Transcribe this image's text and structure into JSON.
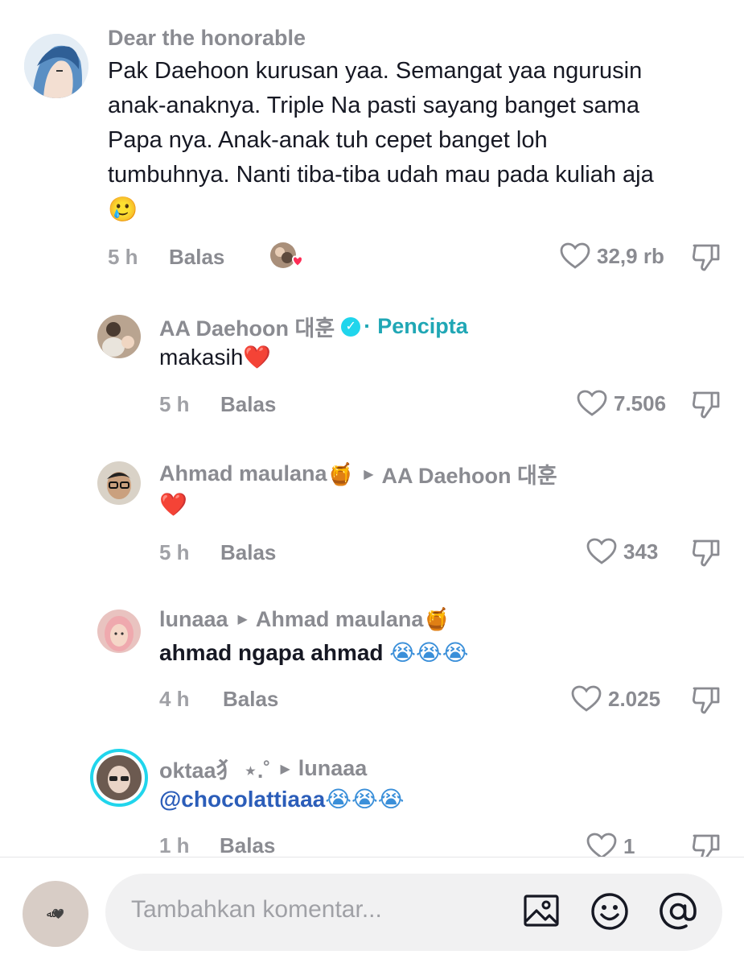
{
  "comments": {
    "main": {
      "username": "Dear the honorable",
      "text_lines": [
        "Pak Daehoon kurusan yaa. Semangat yaa ngurusin",
        "anak-anaknya. Triple Na pasti sayang banget sama",
        "Papa nya. Anak-anak tuh cepet banget loh",
        "tumbuhnya. Nanti tiba-tiba udah mau pada kuliah aja"
      ],
      "emoji": "🥲",
      "time": "5 h",
      "reply_label": "Balas",
      "likes": "32,9 rb"
    },
    "replies": [
      {
        "username": "AA Daehoon 대훈",
        "badge": "✓",
        "separator": "·",
        "role": "Pencipta",
        "text": "makasih",
        "text_emoji": "❤️",
        "time": "5 h",
        "reply_label": "Balas",
        "likes": "7.506"
      },
      {
        "username": "Ahmad maulana",
        "username_emoji": "🍯",
        "reply_to": "AA Daehoon 대훈",
        "text_emoji": "❤️",
        "time": "5 h",
        "reply_label": "Balas",
        "likes": "343"
      },
      {
        "username": "lunaaa",
        "reply_to": "Ahmad maulana",
        "reply_to_emoji": "🍯",
        "text": "ahmad ngapa ahmad ",
        "text_emoji": "😭😭😭",
        "time": "4 h",
        "reply_label": "Balas",
        "likes": "2.025"
      },
      {
        "username": "oktaa⺨ ⋆.˚",
        "reply_to": "lunaaa",
        "mention": "@chocolattiaaa",
        "text_emoji": " 😭😭😭",
        "time": "1 h",
        "reply_label": "Balas",
        "likes": "1"
      }
    ]
  },
  "composer": {
    "avatar_text": "ﷲ🖤",
    "placeholder": "Tambahkan komentar...",
    "icons": [
      "image-icon",
      "emoji-icon",
      "mention-icon"
    ]
  },
  "colors": {
    "creator": "#20a7b5",
    "mention": "#2b5db9",
    "heart": "#fe2c55",
    "muted": "#8a8b91"
  }
}
